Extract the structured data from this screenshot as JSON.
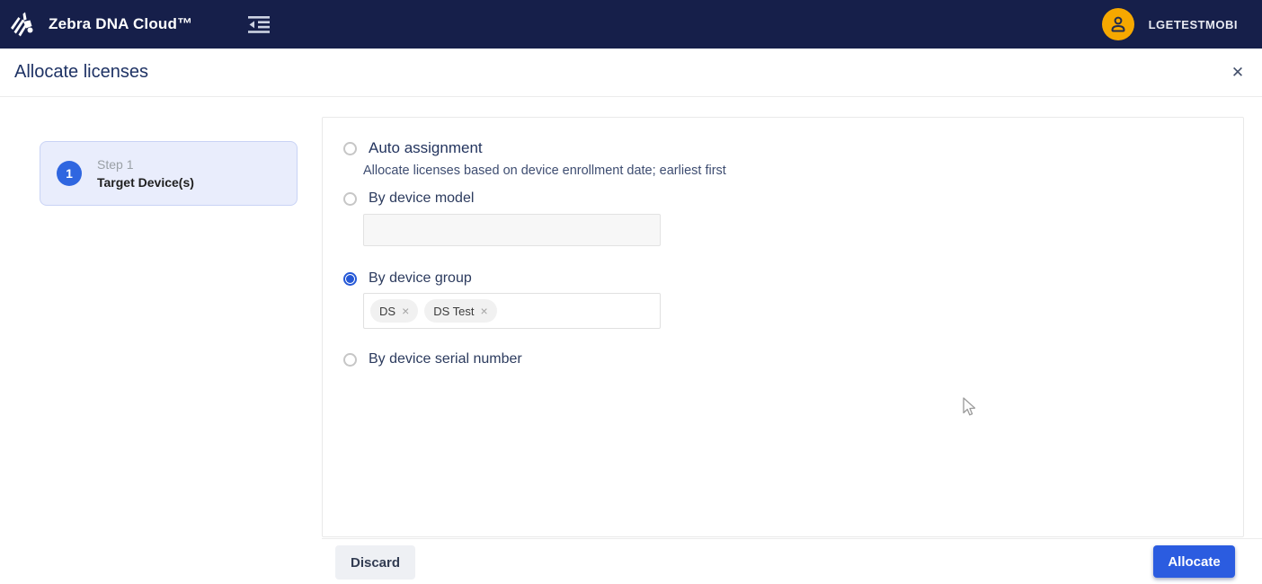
{
  "navbar": {
    "brand": "Zebra DNA Cloud™",
    "username": "LGETESTMOBI"
  },
  "header": {
    "title": "Allocate licenses",
    "close_glyph": "✕"
  },
  "stepper": {
    "steps": [
      {
        "number": "1",
        "label": "Step 1",
        "title": "Target Device(s)",
        "active": true
      }
    ]
  },
  "form": {
    "options": [
      {
        "label": "Auto assignment",
        "description": "Allocate licenses based on device enrollment date; earliest first",
        "selected": false
      },
      {
        "label": "By device model",
        "selected": false,
        "input_value": ""
      },
      {
        "label": "By device group",
        "selected": true,
        "chips": [
          {
            "label": "DS"
          },
          {
            "label": "DS Test"
          }
        ]
      },
      {
        "label": "By device serial number",
        "selected": false
      }
    ]
  },
  "footer": {
    "discard_label": "Discard",
    "allocate_label": "Allocate"
  },
  "icons": {
    "chip_remove_glyph": "×",
    "zebra_logo": "zebra-logo-icon",
    "menu": "indent-menu-icon",
    "avatar": "person-icon",
    "close": "close-icon"
  },
  "colors": {
    "navbar_bg": "#161F4A",
    "accent_blue": "#2B5CE0",
    "avatar_orange": "#F6A800",
    "step_card_bg": "#E9EDFC",
    "step_card_border": "#C9D3F5",
    "step_number_bg": "#2F66E0"
  }
}
